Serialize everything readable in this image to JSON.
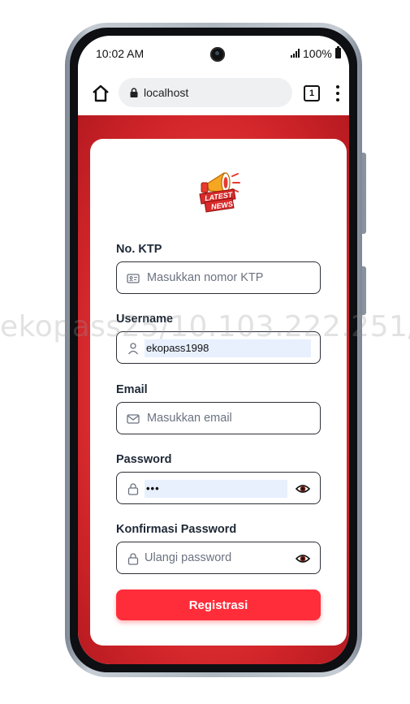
{
  "status_bar": {
    "time": "10:02 AM",
    "battery": "100%"
  },
  "browser": {
    "url": "localhost",
    "tab_count": "1"
  },
  "logo": {
    "line1": "LATEST",
    "line2": "NEWS"
  },
  "form": {
    "ktp": {
      "label": "No. KTP",
      "placeholder": "Masukkan nomor KTP",
      "icon": "id-card-icon"
    },
    "username": {
      "label": "Username",
      "value": "ekopass1998",
      "icon": "user-icon"
    },
    "email": {
      "label": "Email",
      "placeholder": "Masukkan email",
      "icon": "mail-icon"
    },
    "password": {
      "label": "Password",
      "value": "•••",
      "icon": "lock-icon"
    },
    "confirm": {
      "label": "Konfirmasi Password",
      "placeholder": "Ulangi password",
      "icon": "lock-icon"
    },
    "submit_label": "Registrasi"
  },
  "watermark": "ekopass25/10.103.222.251/",
  "colors": {
    "primary": "#ff2d3a",
    "background": "#e8393b",
    "autofill": "#e8f0fe"
  }
}
